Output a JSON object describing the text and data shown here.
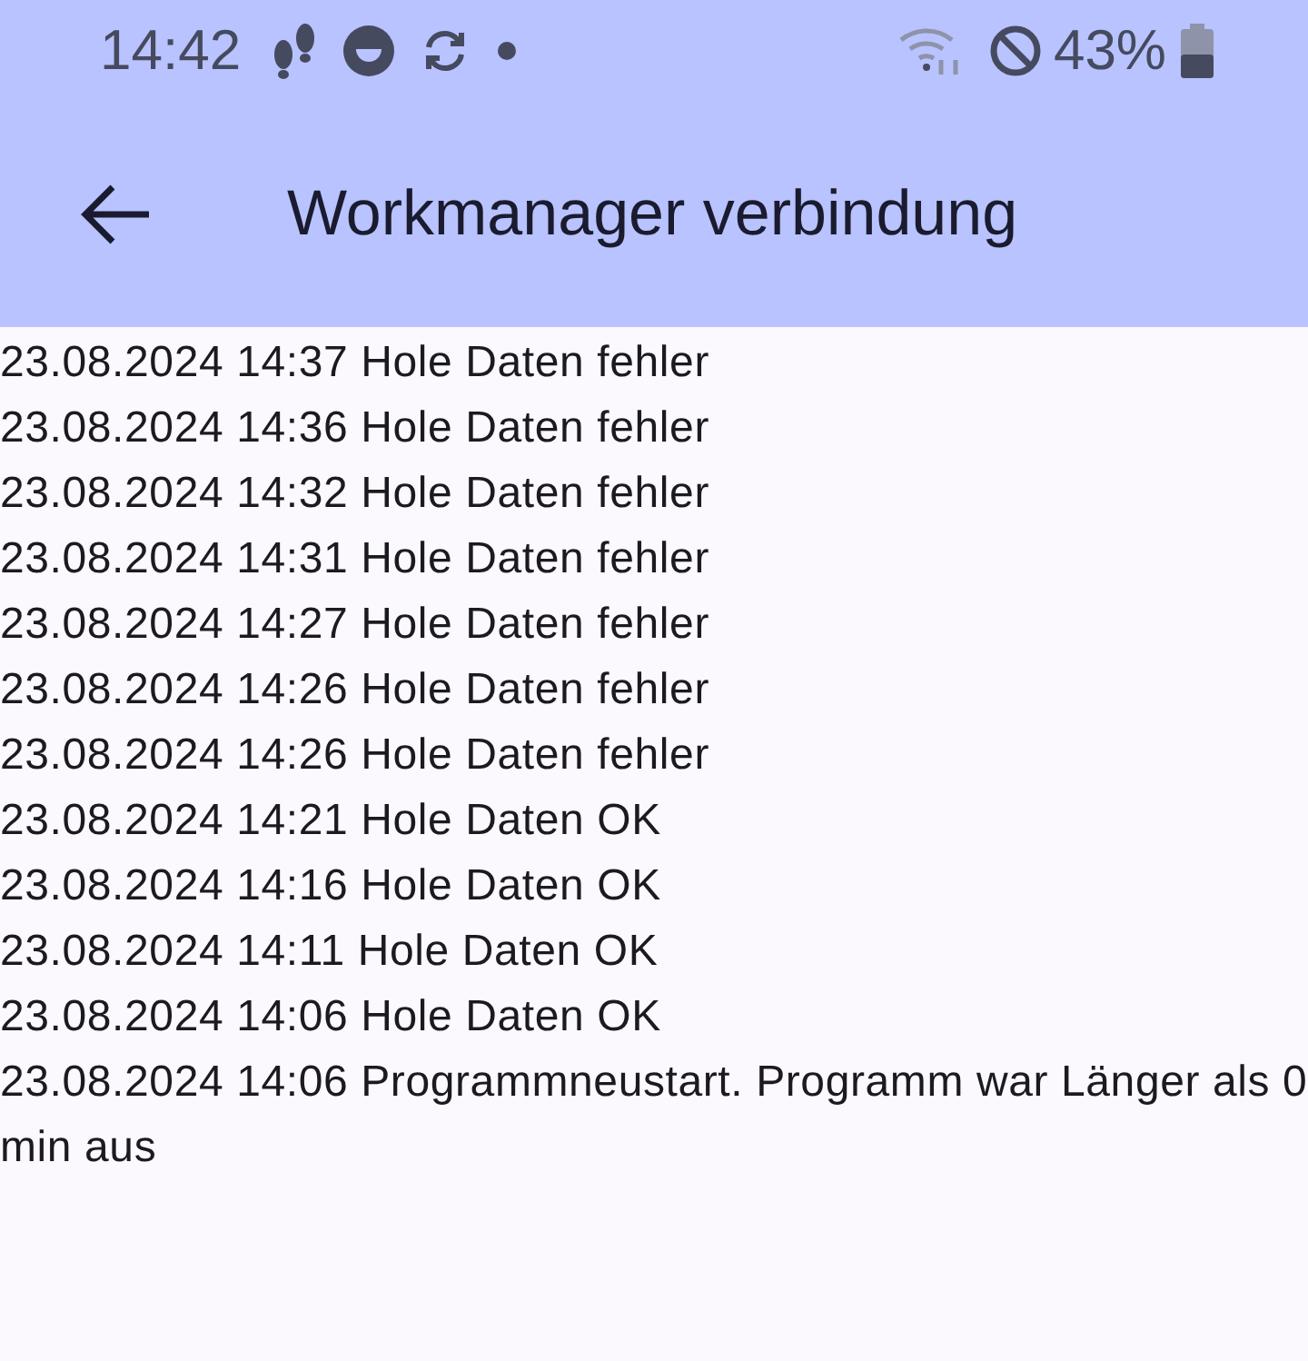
{
  "status_bar": {
    "time": "14:42",
    "battery": "43%"
  },
  "app_bar": {
    "title": "Workmanager verbindung"
  },
  "log": [
    "23.08.2024 14:37 Hole Daten fehler",
    "23.08.2024 14:36 Hole Daten fehler",
    "23.08.2024 14:32 Hole Daten fehler",
    "23.08.2024 14:31 Hole Daten fehler",
    "23.08.2024 14:27 Hole Daten fehler",
    "23.08.2024 14:26 Hole Daten fehler",
    "23.08.2024 14:26 Hole Daten fehler",
    "23.08.2024 14:21 Hole Daten OK",
    "23.08.2024 14:16 Hole Daten OK",
    "23.08.2024 14:11 Hole Daten OK",
    "23.08.2024 14:06 Hole Daten OK",
    "23.08.2024 14:06 Programmneustart. Programm war Länger als 0 min aus"
  ]
}
